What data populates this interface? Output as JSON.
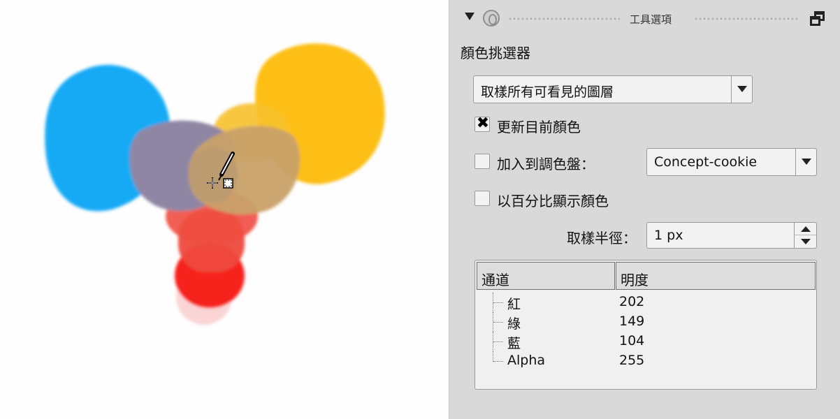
{
  "header": {
    "title": "工具選項",
    "collapse_icon": "triangle-down-icon",
    "pin_icon": "pin-icon",
    "detach_icon": "detach-window-icon"
  },
  "tool": {
    "title": "顏色挑選器"
  },
  "sample_mode": {
    "selected": "取樣所有可看見的圖層"
  },
  "options": {
    "update_current_color": {
      "label": "更新目前顏色",
      "checked": true
    },
    "add_to_palette": {
      "label": "加入到調色盤：",
      "checked": false,
      "palette": "Concept-cookie"
    },
    "show_percentage": {
      "label": "以百分比顯示顏色",
      "checked": false
    }
  },
  "sample_radius": {
    "label": "取樣半徑：",
    "value": "1 px"
  },
  "channels_table": {
    "headers": [
      "通道",
      "明度"
    ],
    "rows": [
      {
        "channel": "紅",
        "value": "202"
      },
      {
        "channel": "綠",
        "value": "149"
      },
      {
        "channel": "藍",
        "value": "104"
      },
      {
        "channel": "Alpha",
        "value": "255"
      }
    ]
  },
  "canvas": {
    "cursor_icon": "eyedropper-cursor-icon",
    "colors": {
      "blue": "#12aaf5",
      "yellow": "#fcbf16",
      "red": "#f5261c",
      "purple_mix": "#8d86a6",
      "tan_mix": "#c8a26a",
      "panel_bg": "#d9d9d9"
    }
  }
}
